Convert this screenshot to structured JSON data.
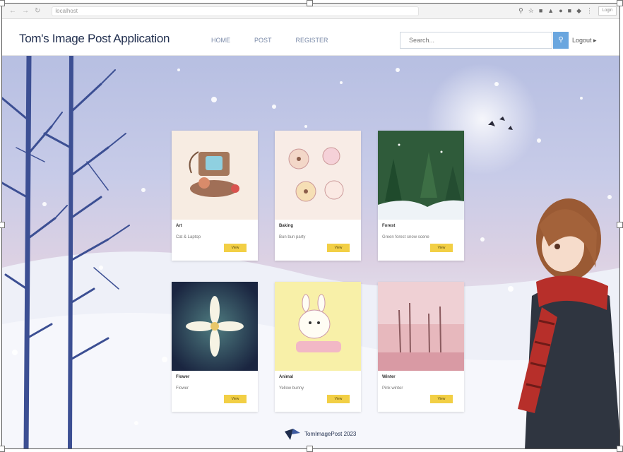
{
  "browser": {
    "url": "localhost",
    "profile_label": "Login"
  },
  "app": {
    "brand": "Tom's Image Post Application",
    "nav": [
      "HOME",
      "POST",
      "REGISTER"
    ],
    "search_placeholder": "Search...",
    "search_icon": "search-icon",
    "user_link": "Logout"
  },
  "cards": [
    {
      "title": "Art",
      "desc": "Cat & Laptop",
      "button": "View"
    },
    {
      "title": "Baking",
      "desc": "Bun bun party",
      "button": "View"
    },
    {
      "title": "Forest",
      "desc": "Green forest snow scene",
      "button": "View"
    },
    {
      "title": "Flower",
      "desc": "Flower",
      "button": "View"
    },
    {
      "title": "Animal",
      "desc": "Yellow bunny",
      "button": "View"
    },
    {
      "title": "Winter",
      "desc": "Pink winter",
      "button": "View"
    }
  ],
  "footer": {
    "text": "TomImagePost 2023"
  },
  "colors": {
    "accent": "#f2cf45",
    "search_button": "#6aa6df",
    "brand": "#1f2d4d"
  }
}
